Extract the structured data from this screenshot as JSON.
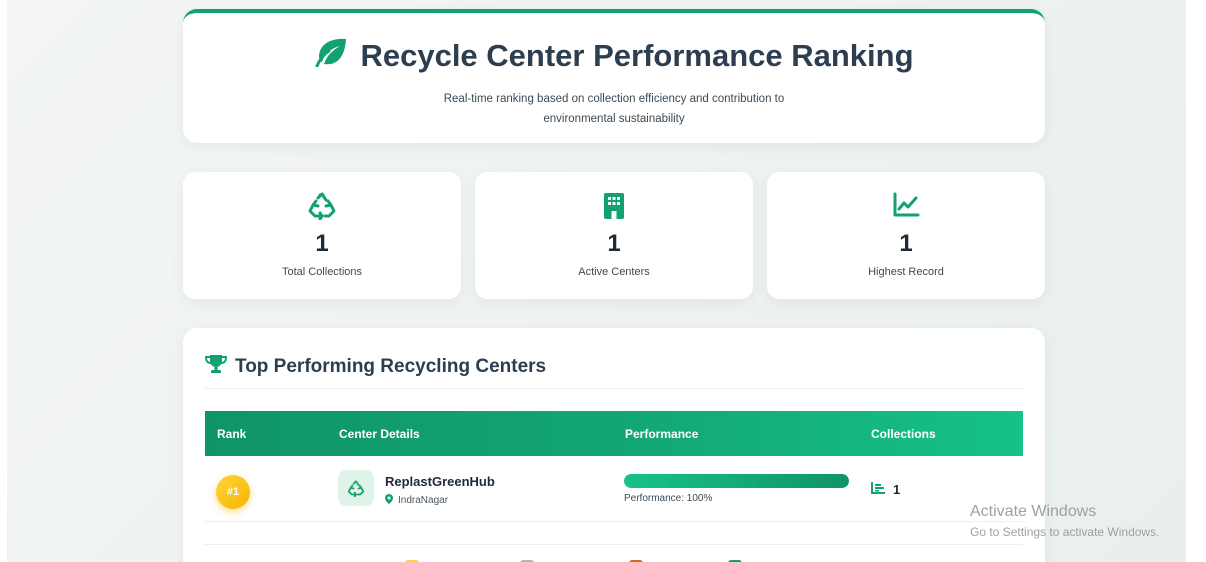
{
  "header": {
    "icon": "leaf-icon",
    "title": "Recycle Center Performance Ranking",
    "subtitle": "Real-time ranking based on collection efficiency and contribution to environmental sustainability",
    "accent_color": "#12a26f"
  },
  "stats": [
    {
      "icon": "recycle-icon",
      "value": "1",
      "label": "Total Collections"
    },
    {
      "icon": "building-icon",
      "value": "1",
      "label": "Active Centers"
    },
    {
      "icon": "chart-line-icon",
      "value": "1",
      "label": "Highest Record"
    }
  ],
  "ranking": {
    "icon": "trophy-icon",
    "title": "Top Performing Recycling Centers",
    "columns": [
      "Rank",
      "Center Details",
      "Performance",
      "Collections"
    ],
    "rows": [
      {
        "rank": "#1",
        "name": "ReplastGreenHub",
        "location": "IndraNagar",
        "performance_fraction": 1.0,
        "performance_label": "Performance: 100%",
        "collections": "1"
      }
    ],
    "legend_colors": [
      "#ffd43b",
      "#b0b6ba",
      "#d2691e",
      "#12a26f"
    ]
  },
  "watermark": {
    "title": "Activate Windows",
    "subtitle": "Go to Settings to activate Windows."
  }
}
